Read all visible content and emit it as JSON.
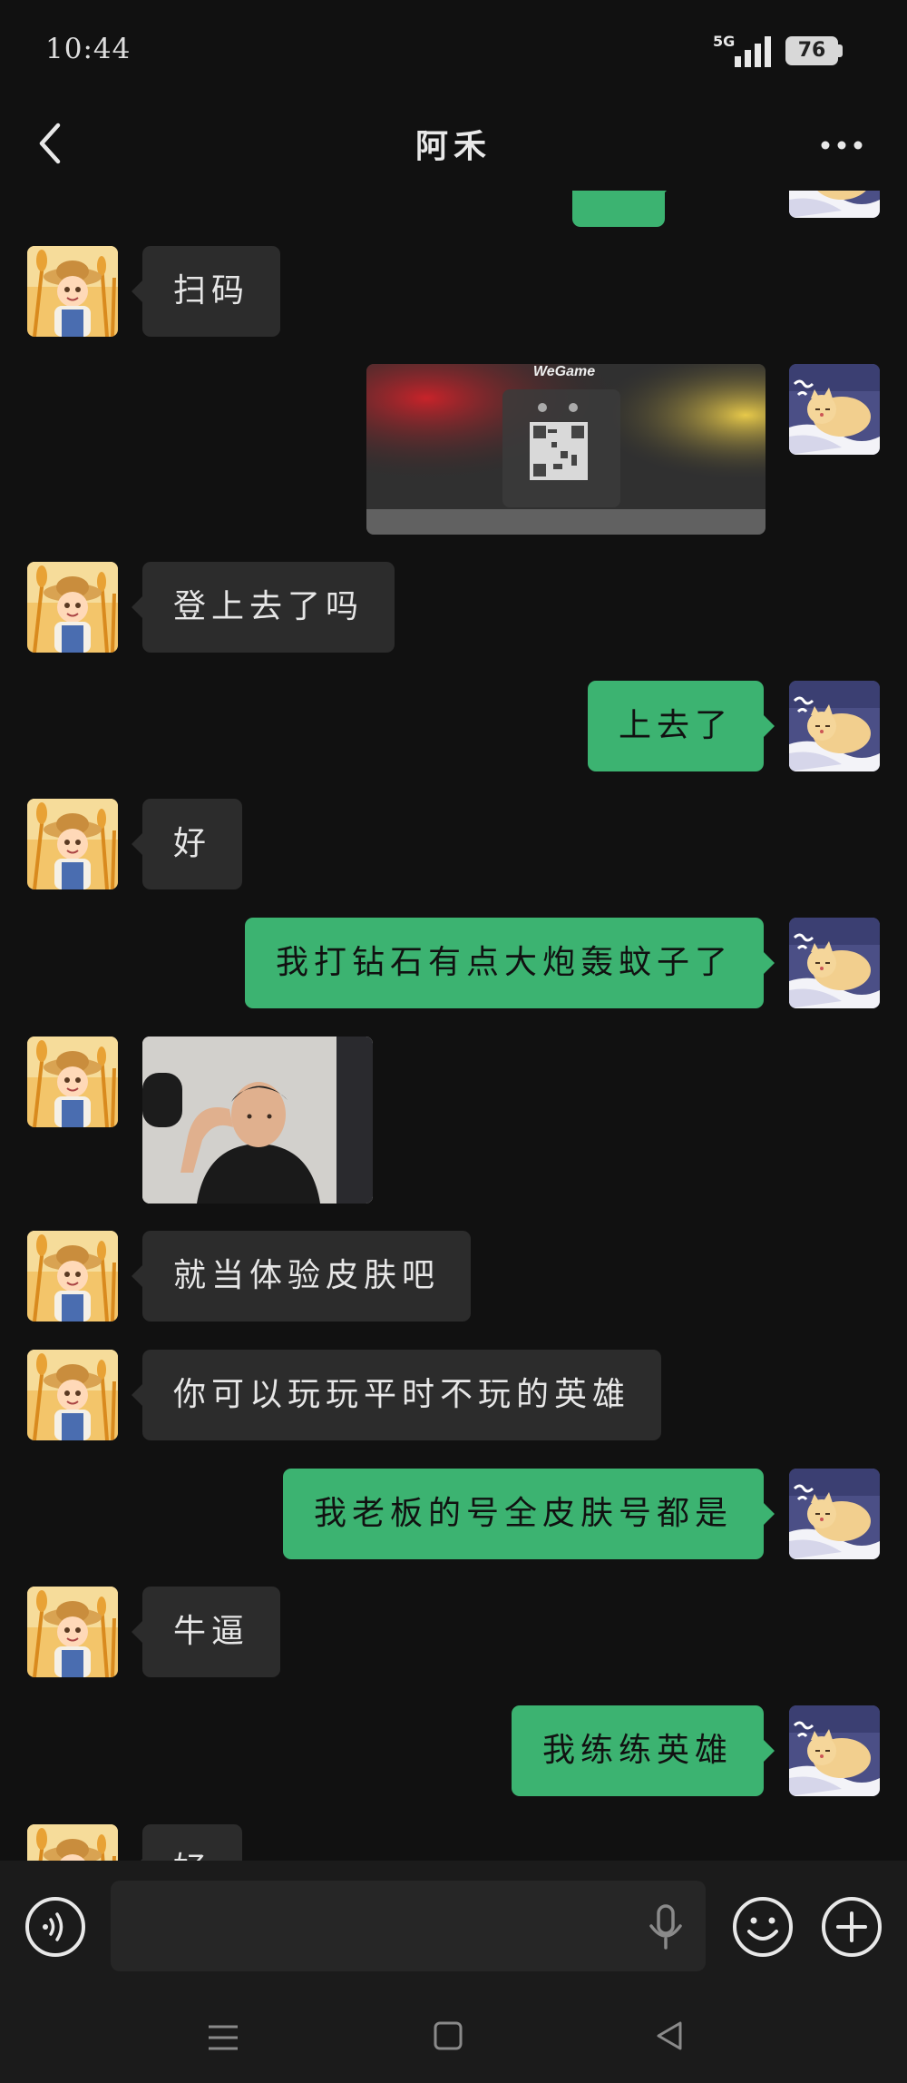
{
  "status_bar": {
    "time": "10:44",
    "network": "5G",
    "battery": "76"
  },
  "header": {
    "title": "阿禾"
  },
  "messages": [
    {
      "side": "in",
      "text": "扫码"
    },
    {
      "side": "out",
      "type": "image",
      "image_caption": "WeGame"
    },
    {
      "side": "in",
      "text": "登上去了吗"
    },
    {
      "side": "out",
      "text": "上去了"
    },
    {
      "side": "in",
      "text": "好"
    },
    {
      "side": "out",
      "text": "我打钻石有点大炮轰蚊子了"
    },
    {
      "side": "in",
      "type": "image"
    },
    {
      "side": "in",
      "text": "就当体验皮肤吧"
    },
    {
      "side": "in",
      "text": "你可以玩玩平时不玩的英雄"
    },
    {
      "side": "out",
      "text": "我老板的号全皮肤号都是"
    },
    {
      "side": "in",
      "text": "牛逼"
    },
    {
      "side": "out",
      "text": "我练练英雄"
    },
    {
      "side": "in",
      "text": "好"
    }
  ],
  "input_bar": {
    "placeholder": ""
  },
  "colors": {
    "background": "#111111",
    "incoming_bubble": "#2c2c2c",
    "outgoing_bubble": "#3cb371"
  },
  "icons": [
    "back-arrow-icon",
    "more-dots-icon",
    "voice-icon",
    "mic-icon",
    "emoji-icon",
    "plus-icon",
    "nav-menu-icon",
    "nav-home-icon",
    "nav-back-icon"
  ]
}
